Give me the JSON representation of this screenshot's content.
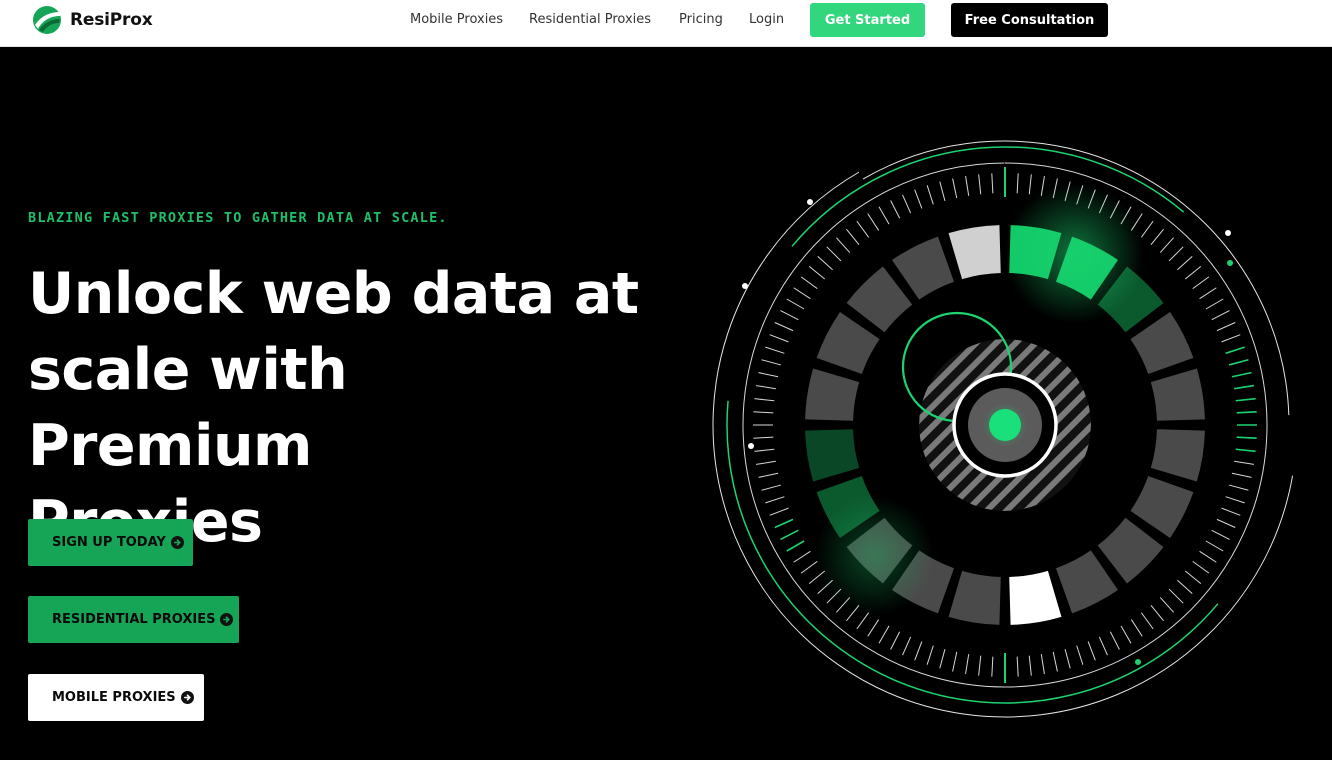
{
  "brand": {
    "name": "ResiProx",
    "accent": "#32d67d",
    "dark_green": "#16a557"
  },
  "nav": {
    "links": [
      "Mobile Proxies",
      "Residential Proxies",
      "Pricing",
      "Login"
    ],
    "get_started": "Get Started",
    "consultation": "Free Consultation"
  },
  "hero": {
    "eyebrow": "BLAZING FAST PROXIES TO GATHER DATA AT SCALE.",
    "headline_lines": [
      "Unlock web data at",
      "scale with Premium",
      "Proxies"
    ],
    "buttons": [
      {
        "label": "SIGN UP TODAY",
        "icon": "arrow-circle-right-icon"
      },
      {
        "label": "RESIDENTIAL PROXIES",
        "icon": "arrow-circle-right-icon"
      },
      {
        "label": "MOBILE PROXIES",
        "icon": "arrow-circle-right-icon"
      }
    ]
  }
}
